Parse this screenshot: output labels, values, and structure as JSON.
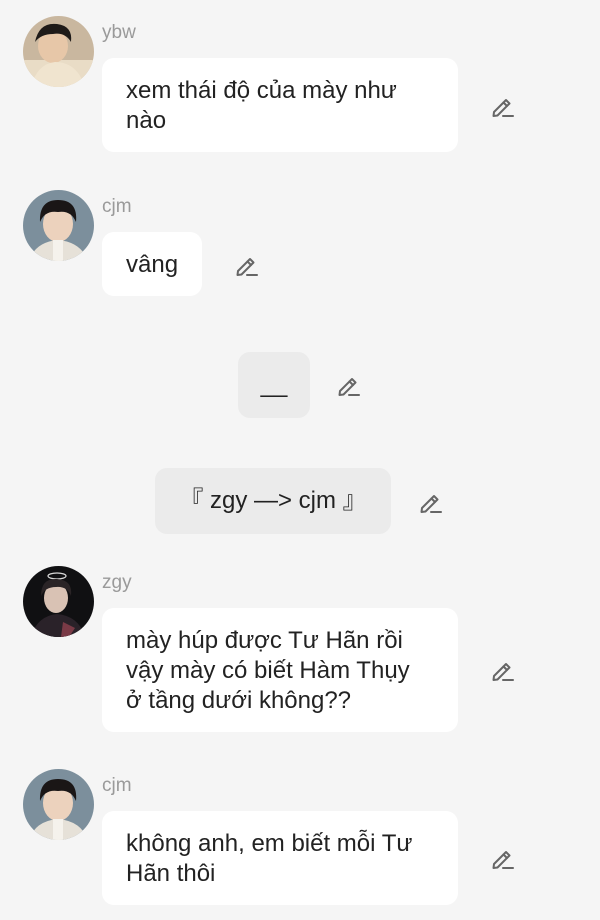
{
  "messages": [
    {
      "username": "ybw",
      "text": "xem thái độ của mày như nào",
      "line1": "xem thái độ của mày như",
      "line2": "nào"
    },
    {
      "username": "cjm",
      "text": "vâng"
    },
    {
      "narration": "__"
    },
    {
      "narration": "『 zgy —> cjm 』"
    },
    {
      "username": "zgy",
      "line1": "mày húp được Tư Hãn rồi",
      "line2": "vậy mày có biết Hàm Thụy",
      "line3": "ở tầng dưới không??"
    },
    {
      "username": "cjm",
      "line1": "không anh, em biết mỗi Tư",
      "line2": "Hãn thôi"
    }
  ],
  "icons": {
    "avatar": "profile-photo",
    "edit": "pencil-icon"
  },
  "colors": {
    "background": "#f5f5f5",
    "bubble": "#ffffff",
    "narration_bubble": "#ebebeb",
    "username": "#9a9a9a",
    "text": "#222222"
  }
}
